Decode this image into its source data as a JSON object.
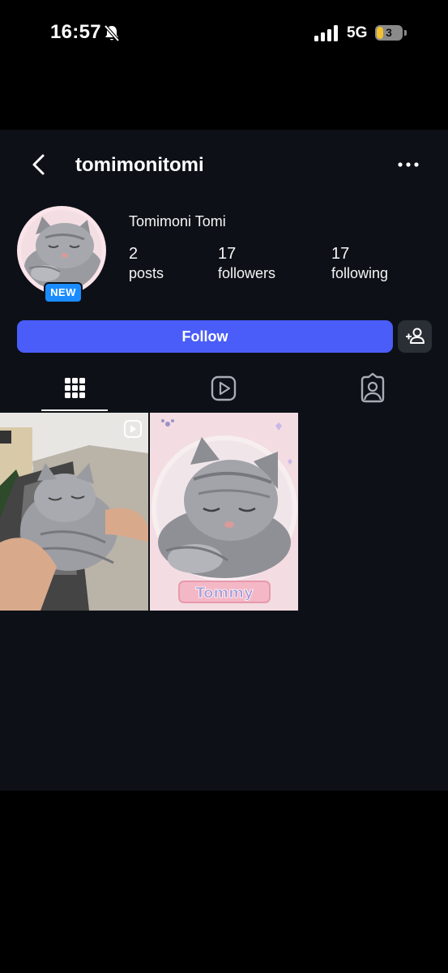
{
  "status_bar": {
    "time": "16:57",
    "network": "5G",
    "battery_level": "3"
  },
  "profile": {
    "username": "tomimonitomi",
    "display_name": "Tomimoni Tomi",
    "new_badge": "NEW",
    "stats": [
      {
        "value": "2",
        "label": "posts"
      },
      {
        "value": "17",
        "label": "followers"
      },
      {
        "value": "17",
        "label": "following"
      }
    ]
  },
  "actions": {
    "follow_label": "Follow"
  },
  "tabs": [
    {
      "icon": "grid-icon",
      "active": true
    },
    {
      "icon": "reels-icon",
      "active": false
    },
    {
      "icon": "tagged-icon",
      "active": false
    }
  ],
  "posts": [
    {
      "type": "reel",
      "thumbnail": "kitten-sleeping-on-arm"
    },
    {
      "type": "image",
      "thumbnail": "kitten-portrait-frame",
      "caption": "Tommy"
    }
  ],
  "colors": {
    "background": "#0d1117",
    "accent": "#4a5df9",
    "badge": "#1a8cff",
    "secondary_button": "#2a2e35"
  }
}
